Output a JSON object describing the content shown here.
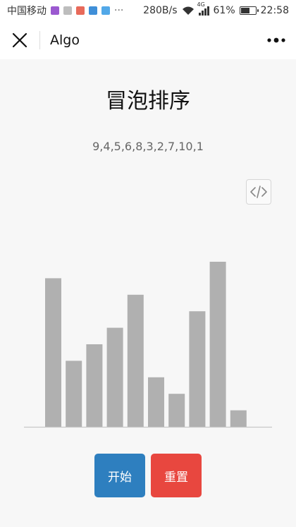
{
  "status_bar": {
    "carrier": "中国移动",
    "speed": "280B/s",
    "network": "4G",
    "battery": "61%",
    "battery_level": 0.61,
    "time": "22:58",
    "notification_colors": [
      "#9b59d0",
      "#bdbdbd",
      "#e86a5a",
      "#3f8fd8",
      "#52a8e8"
    ]
  },
  "nav": {
    "title": "Algo"
  },
  "page": {
    "title": "冒泡排序",
    "array_text": "9,4,5,6,8,3,2,7,10,1"
  },
  "chart_data": {
    "type": "bar",
    "values": [
      9,
      4,
      5,
      6,
      8,
      3,
      2,
      7,
      10,
      1
    ],
    "ylim": [
      0,
      10
    ],
    "bar_color": "#b0b0b0",
    "axis_color": "#c8c8c8",
    "grid": false
  },
  "controls": {
    "start_label": "开始",
    "reset_label": "重置",
    "start_color": "#2e7fbf",
    "reset_color": "#e8473f"
  }
}
